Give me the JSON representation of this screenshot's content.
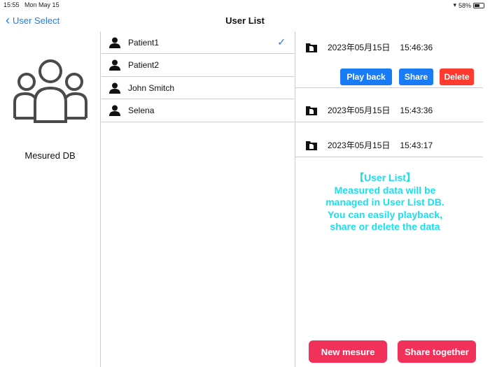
{
  "status": {
    "time": "15:55",
    "date": "Mon May 15",
    "battery": "58%"
  },
  "nav": {
    "back": "User Select",
    "title": "User List"
  },
  "left": {
    "label": "Mesured DB"
  },
  "users": [
    {
      "name": "Patient1",
      "selected": true
    },
    {
      "name": "Patient2"
    },
    {
      "name": "John Smitch"
    },
    {
      "name": "Selena"
    }
  ],
  "records": [
    {
      "date": "2023年05月15日",
      "time": "15:46:36"
    },
    {
      "date": "2023年05月15日",
      "time": "15:43:36"
    },
    {
      "date": "2023年05月15日",
      "time": "15:43:17"
    }
  ],
  "actions": {
    "playback": "Play back",
    "share": "Share",
    "delete": "Delete"
  },
  "info": "【User List】\nMeasured data will be\nmanaged in User List DB.\nYou can easily playback,\nshare or delete the data",
  "bottom": {
    "new": "New mesure",
    "share_together": "Share together"
  },
  "colors": {
    "blue": "#1a7cf5",
    "red": "#ff3b30",
    "pink": "#f0325a",
    "cyan": "#19e0ef"
  }
}
